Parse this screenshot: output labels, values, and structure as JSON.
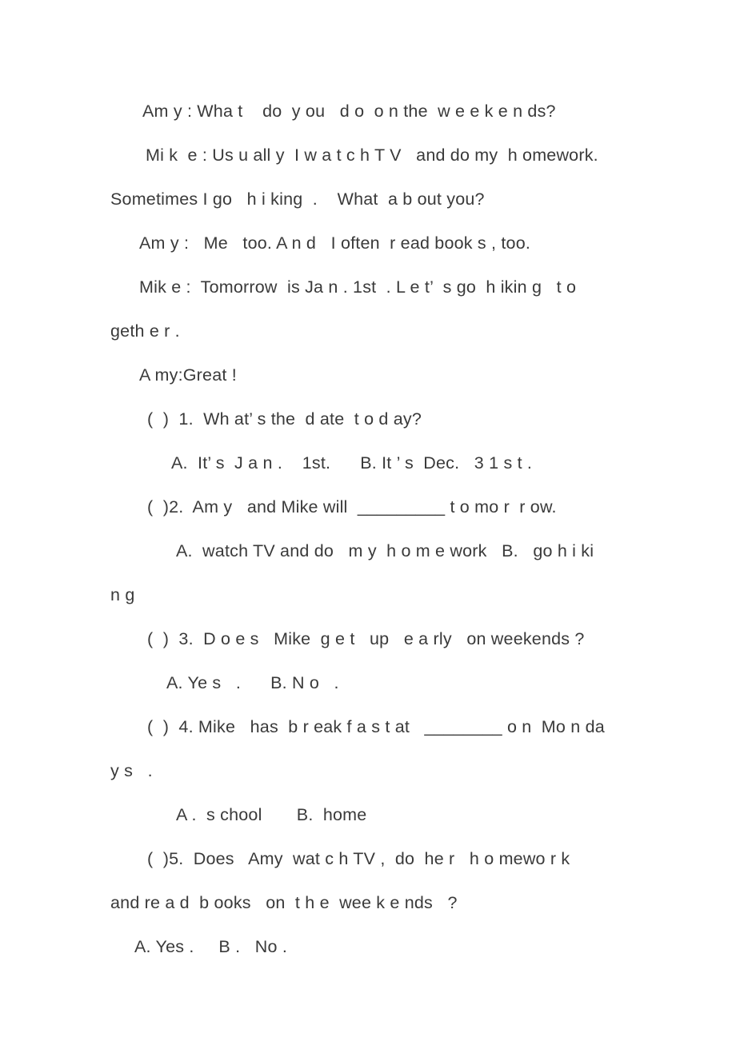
{
  "document": {
    "type": "english-worksheet",
    "background_color": "#ffffff",
    "text_color": "#3a3a3a",
    "lines": [
      {
        "id": "l1",
        "text": "Am y : Wha t    do  y ou   d o  o n the  w e e k e n ds?"
      },
      {
        "id": "l2",
        "text": "Mi k  e : Us u all y  I w a t c h T V   and do my  h omework."
      },
      {
        "id": "l3",
        "text": "Sometimes I go   h i king  .    What  a b out you?"
      },
      {
        "id": "l4",
        "text": "Am y :   Me   too. A n d   I often  r ead book s , too."
      },
      {
        "id": "l5",
        "text": "Mik e :  Tomorrow  is Ja n . 1st  . L e t’  s go  h ikin g   t o"
      },
      {
        "id": "l6",
        "text": "geth e r ."
      },
      {
        "id": "l7",
        "text": "A my:Great !"
      },
      {
        "id": "l8",
        "text": "(  )  1.  Wh at’ s the  d ate  t o d ay?"
      },
      {
        "id": "l9",
        "text": "A.  It’ s  J a n .    1st.      B. It ’ s  Dec.   3 1 s t ."
      },
      {
        "id": "l10",
        "text": "(  )2.  Am y   and Mike will  _________ t o mo r  r ow."
      },
      {
        "id": "l11",
        "text": "A.  watch TV and do   m y  h o m e work   B.   go h i ki"
      },
      {
        "id": "l12",
        "text": "n g"
      },
      {
        "id": "l13",
        "text": "(  )  3.  D o e s   Mike  g e t   up   e a rly   on weekends ?"
      },
      {
        "id": "l14",
        "text": "A. Ye s   .      B. N o   ."
      },
      {
        "id": "l15",
        "text": "(  )  4. Mike   has  b r eak f a s t at   ________ o n  Mo n da"
      },
      {
        "id": "l16",
        "text": "y s   ."
      },
      {
        "id": "l17",
        "text": "A .  s chool       B.  home"
      },
      {
        "id": "l18",
        "text": "(  )5.  Does   Amy  wat c h TV ,  do  he r   h o mewo r k"
      },
      {
        "id": "l19",
        "text": "and re a d  b ooks   on  t h e  wee k e nds   ?"
      },
      {
        "id": "l20",
        "text": "A. Yes .     B .   No ."
      }
    ]
  }
}
